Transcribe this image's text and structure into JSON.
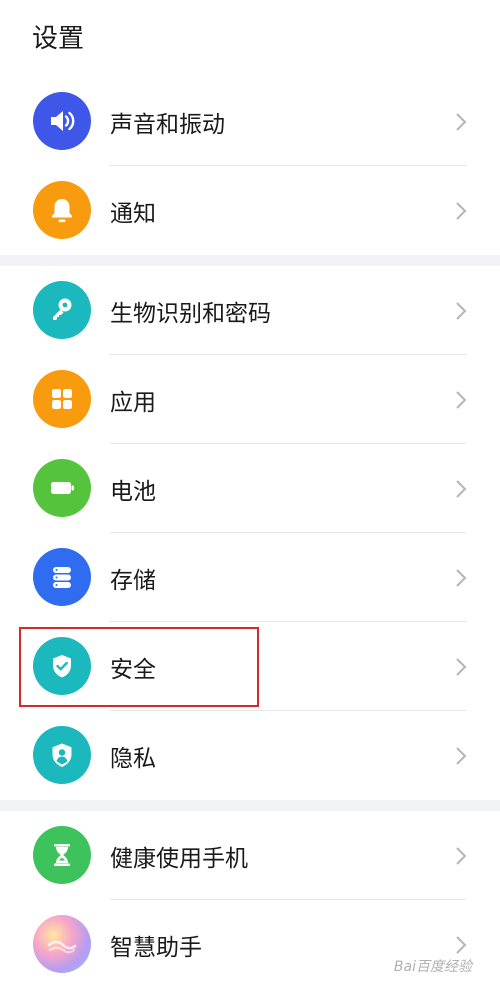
{
  "title": "设置",
  "colors": {
    "sound": "#3f57e8",
    "notify": "#f99b0e",
    "biometric": "#1bb8be",
    "apps": "#f99b0e",
    "battery": "#55c33b",
    "storage": "#2f6cf0",
    "security": "#1bb8be",
    "privacy": "#1bb8be",
    "health": "#3ec25c",
    "highlight": "#d42a2a"
  },
  "groups": [
    {
      "items": [
        {
          "label": "声音和振动",
          "icon": "speaker-icon"
        },
        {
          "label": "通知",
          "icon": "bell-icon"
        }
      ]
    },
    {
      "items": [
        {
          "label": "生物识别和密码",
          "icon": "key-icon"
        },
        {
          "label": "应用",
          "icon": "apps-grid-icon"
        },
        {
          "label": "电池",
          "icon": "battery-icon"
        },
        {
          "label": "存储",
          "icon": "storage-icon"
        },
        {
          "label": "安全",
          "icon": "shield-check-icon"
        },
        {
          "label": "隐私",
          "icon": "privacy-shield-icon"
        }
      ]
    },
    {
      "items": [
        {
          "label": "健康使用手机",
          "icon": "hourglass-icon"
        },
        {
          "label": "智慧助手",
          "icon": "assistant-orb-icon"
        }
      ]
    }
  ],
  "watermark": "Bai百度经验"
}
